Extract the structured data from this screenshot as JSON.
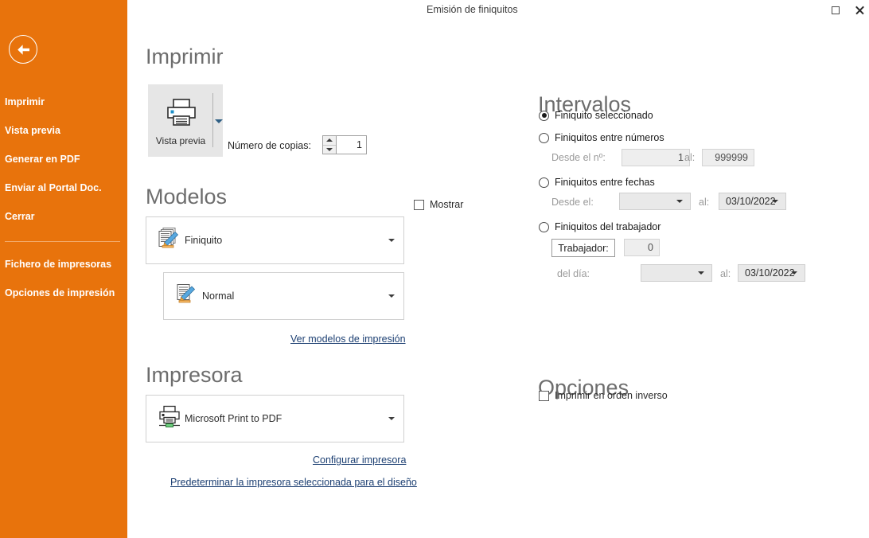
{
  "window": {
    "title": "Emisión de finiquitos",
    "restore_icon": "restore-icon",
    "close_icon": "close-icon"
  },
  "sidebar": {
    "back_icon": "back-arrow-icon",
    "items": [
      {
        "label": "Imprimir"
      },
      {
        "label": "Vista previa"
      },
      {
        "label": "Generar en PDF"
      },
      {
        "label": "Enviar al Portal Doc."
      },
      {
        "label": "Cerrar"
      },
      {
        "label": "Fichero de impresoras"
      },
      {
        "label": "Opciones de impresión"
      }
    ]
  },
  "print": {
    "heading": "Imprimir",
    "preview_button_label": "Vista previa",
    "preview_icon": "printer-icon",
    "copies_label": "Número de copias:",
    "copies_value": "1"
  },
  "models": {
    "heading": "Modelos",
    "show_checkbox_label": "Mostrar",
    "show_checked": false,
    "model_primary": {
      "value": "Finiquito",
      "icon": "documents-stack-icon"
    },
    "model_secondary": {
      "value": "Normal",
      "icon": "document-icon"
    },
    "view_models_link": "Ver modelos de impresión"
  },
  "printer": {
    "heading": "Impresora",
    "selected": {
      "value": "Microsoft Print to PDF",
      "icon": "printer-network-icon"
    },
    "configure_link": "Configurar impresora",
    "set_default_link": "Predeterminar la impresora seleccionada para el diseño"
  },
  "ranges": {
    "heading": "Intervalos",
    "options": [
      {
        "label": "Finiquito seleccionado",
        "checked": true
      },
      {
        "label": "Finiquitos entre números",
        "checked": false
      },
      {
        "label": "Finiquitos entre fechas",
        "checked": false
      },
      {
        "label": "Finiquitos del trabajador",
        "checked": false
      }
    ],
    "numbers": {
      "from_label": "Desde el nº:",
      "from_value": "1",
      "to_label": "al:",
      "to_value": "999999"
    },
    "dates": {
      "from_label": "Desde el:",
      "from_value": "",
      "to_label": "al:",
      "to_value": "03/10/2022"
    },
    "worker": {
      "button_label": "Trabajador:",
      "id_value": "0",
      "from_label": "del día:",
      "from_value": "",
      "to_label": "al:",
      "to_value": "03/10/2022"
    }
  },
  "options": {
    "heading": "Opciones",
    "reverse_order_label": "Imprimir en orden inverso",
    "reverse_order_checked": false
  },
  "colors": {
    "sidebar_orange": "#e8730c",
    "heading_gray": "#6d6d6d",
    "link_blue": "#1c3f72"
  }
}
